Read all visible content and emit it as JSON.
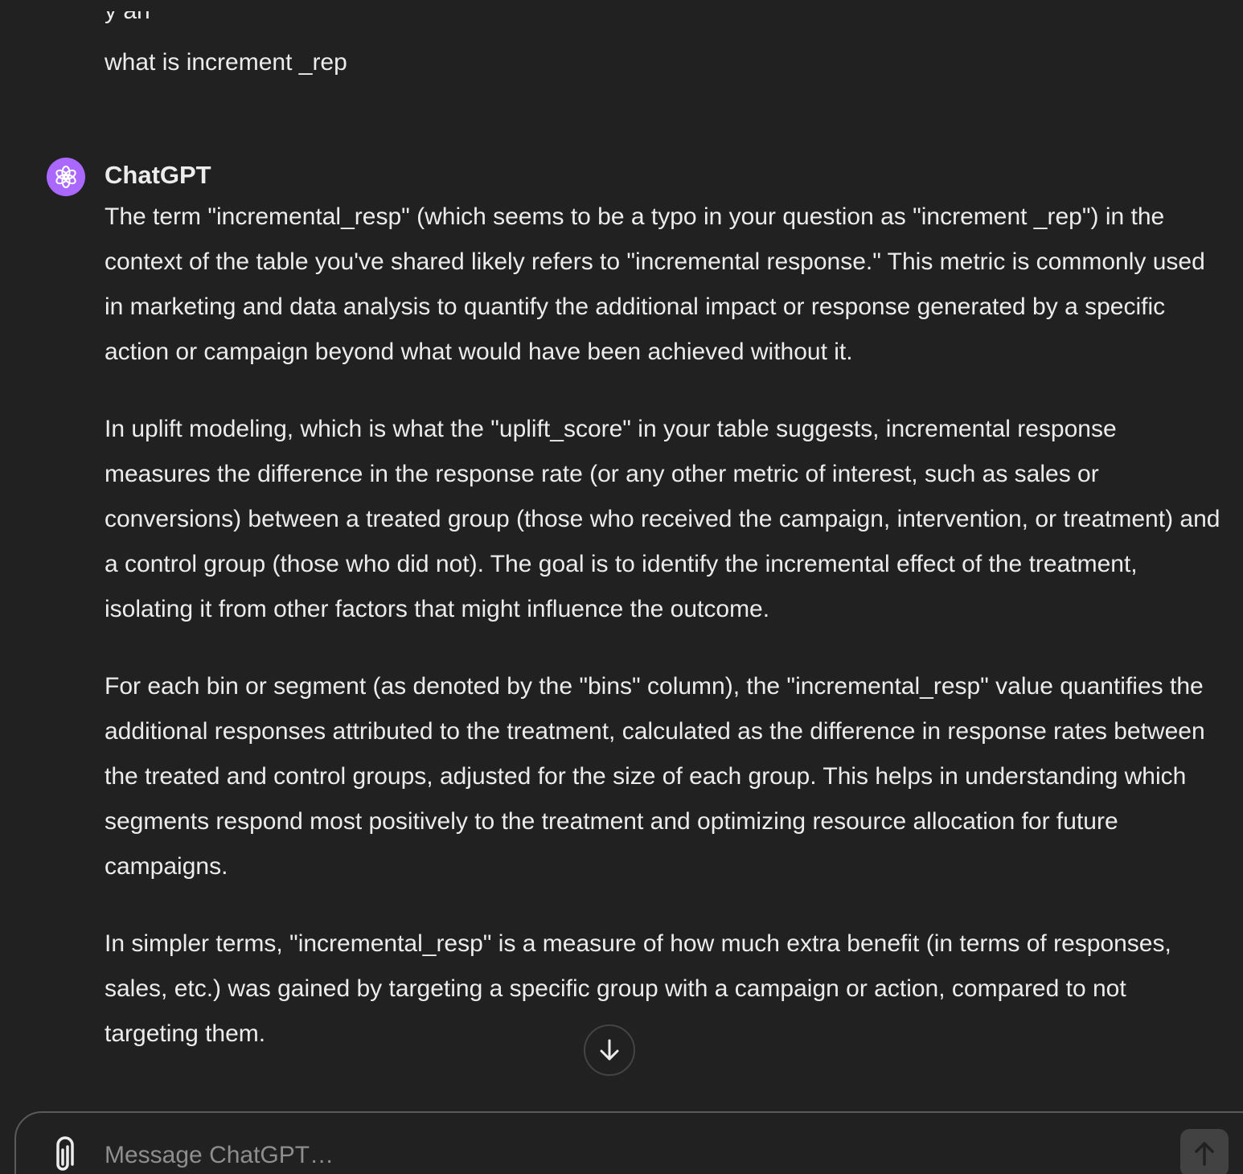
{
  "conversation": {
    "previous_line_clipped": "y an",
    "user_message": "what is increment _rep",
    "assistant_name": "ChatGPT",
    "assistant_paragraphs": [
      "The term \"incremental_resp\" (which seems to be a typo in your question as \"increment _rep\") in the context of the table you've shared likely refers to \"incremental response.\" This metric is commonly used in marketing and data analysis to quantify the additional impact or response generated by a specific action or campaign beyond what would have been achieved without it.",
      "In uplift modeling, which is what the \"uplift_score\" in your table suggests, incremental response measures the difference in the response rate (or any other metric of interest, such as sales or conversions) between a treated group (those who received the campaign, intervention, or treatment) and a control group (those who did not). The goal is to identify the incremental effect of the treatment, isolating it from other factors that might influence the outcome.",
      "For each bin or segment (as denoted by the \"bins\" column), the \"incremental_resp\" value quantifies the additional responses attributed to the treatment, calculated as the difference in response rates between the treated and control groups, adjusted for the size of each group. This helps in understanding which segments respond most positively to the treatment and optimizing resource allocation for future campaigns.",
      "In simpler terms, \"incremental_resp\" is a measure of how much extra benefit (in terms of responses, sales, etc.) was gained by targeting a specific group with a campaign or action, compared to not targeting them."
    ]
  },
  "composer": {
    "placeholder": "Message ChatGPT…",
    "value": ""
  },
  "icons": {
    "avatar": "openai-logo-icon",
    "scroll": "arrow-down-icon",
    "attach": "paperclip-icon",
    "send": "arrow-up-icon"
  },
  "colors": {
    "background": "#212121",
    "text": "#ececec",
    "avatar_bg": "#ab68ff",
    "placeholder": "#8e8e8e",
    "send_bg": "#424242"
  }
}
